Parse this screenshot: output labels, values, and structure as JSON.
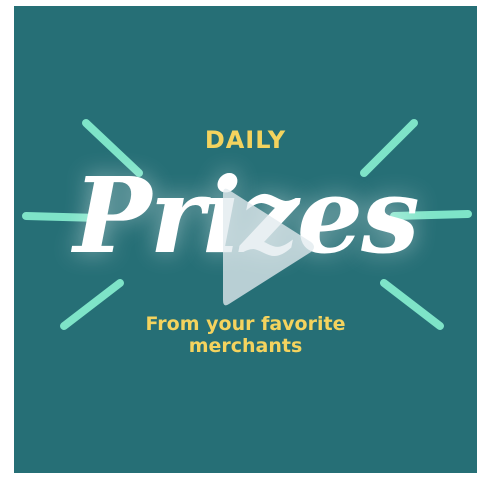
{
  "card": {
    "kicker": "DAILY",
    "headline": "Prizes",
    "tagline_line1": "From your favorite",
    "tagline_line2": "merchants"
  },
  "colors": {
    "background": "#266f76",
    "kicker_and_tagline": "#f4d35e",
    "headline": "#ffffff",
    "rays": "#7ee4c8",
    "play_overlay": "rgba(225,235,238,0.75)"
  },
  "icons": {
    "play": "play-icon"
  }
}
